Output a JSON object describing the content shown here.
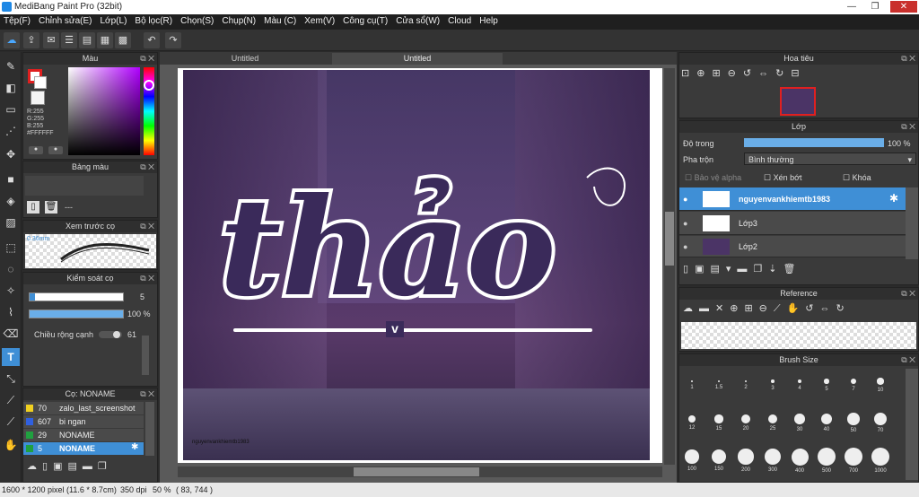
{
  "window": {
    "title": "MediBang Paint Pro (32bit)",
    "minimize": "—",
    "restore": "❐",
    "close": "✕"
  },
  "menu": [
    "Tệp(F)",
    "Chỉnh sửa(E)",
    "Lớp(L)",
    "Bộ lọc(R)",
    "Chọn(S)",
    "Chụp(N)",
    "Màu (C)",
    "Xem(V)",
    "Công cụ(T)",
    "Cửa sổ(W)",
    "Cloud",
    "Help"
  ],
  "tabs": [
    "Untitled",
    "Untitled"
  ],
  "color_panel": {
    "title": "Màu",
    "r": "R:255",
    "g": "G:255",
    "b": "B:255",
    "hex": "#FFFFFF"
  },
  "palette_panel": {
    "title": "Bảng màu",
    "empty": "---"
  },
  "brush_preview": {
    "title": "Xem trước cọ",
    "size": "0.36mm"
  },
  "brush_control": {
    "title": "Kiểm soát cọ",
    "size_value": "5",
    "opacity_value": "100 %",
    "width_label": "Chiều rộng cạnh",
    "width_value": "61"
  },
  "brush_list": {
    "title": "Cọ: NONAME",
    "items": [
      {
        "size": "70",
        "name": "zalo_last_screenshot",
        "color": "#f0d020"
      },
      {
        "size": "607",
        "name": "bi ngan",
        "color": "#3060e0"
      },
      {
        "size": "29",
        "name": "NONAME",
        "color": "#20a040"
      },
      {
        "size": "5",
        "name": "NONAME",
        "color": "#20a040"
      }
    ]
  },
  "navigator": {
    "title": "Hoa tiêu"
  },
  "layer_panel": {
    "title": "Lớp",
    "opacity_label": "Độ trong",
    "opacity_value": "100 %",
    "blend_label": "Pha trộn",
    "blend_value": "Bình thường",
    "protect_alpha": "Bảo vệ alpha",
    "clipping": "Xén bớt",
    "lock": "Khóa",
    "layers": [
      {
        "name": "nguyenvankhiemtb1983",
        "selected": true
      },
      {
        "name": "Lớp3",
        "selected": false
      },
      {
        "name": "Lớp2",
        "selected": false
      }
    ]
  },
  "reference_panel": {
    "title": "Reference"
  },
  "brush_size_panel": {
    "title": "Brush Size",
    "sizes": [
      "1",
      "1.5",
      "2",
      "3",
      "4",
      "5",
      "7",
      "10",
      "12",
      "15",
      "20",
      "25",
      "30",
      "40",
      "50",
      "70",
      "100",
      "150",
      "200",
      "300",
      "400",
      "500",
      "700",
      "1000"
    ]
  },
  "canvas": {
    "text": "thảo",
    "letter": "v",
    "signature": "nguyenvankhiemtb1983"
  },
  "status": {
    "dims": "1600 * 1200 pixel",
    "physical": "(11.6 * 8.7cm)",
    "dpi": "350 dpi",
    "zoom": "50 %",
    "coords": "( 83, 744 )"
  },
  "colors": {
    "accent": "#3f8fd6",
    "selected_layer": "#3f8fd6"
  }
}
